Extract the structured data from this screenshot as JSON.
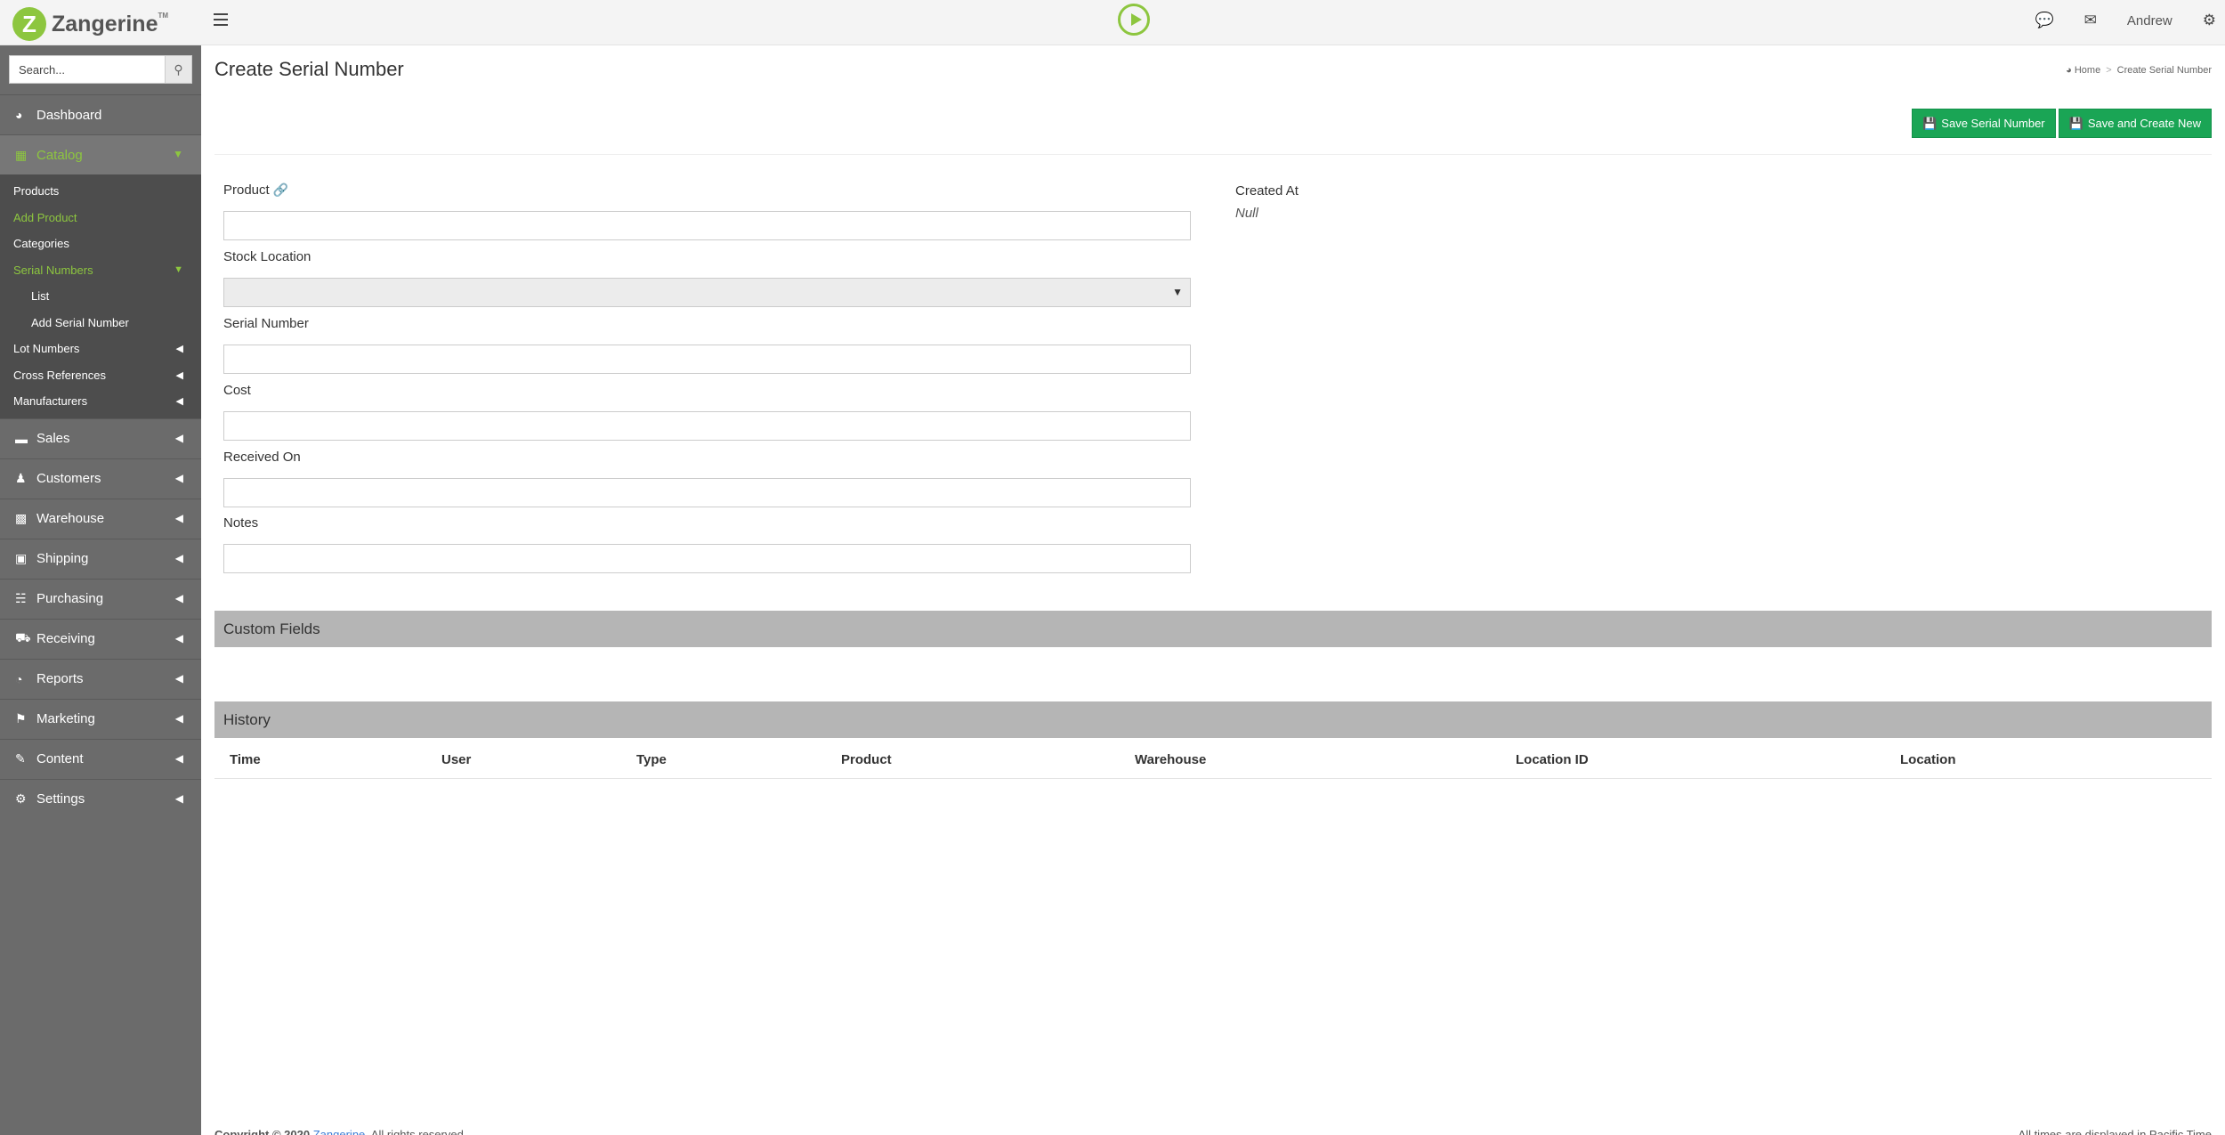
{
  "app": {
    "logo_text": "Zangerine",
    "logo_tm": "TM",
    "user_name": "Andrew"
  },
  "colors": {
    "brand_green": "#8dc63f",
    "button_green": "#1aa555",
    "sidebar_bg": "#6b6b6b"
  },
  "search": {
    "placeholder": "Search..."
  },
  "sidebar": {
    "dashboard": "Dashboard",
    "catalog": "Catalog",
    "catalog_items": {
      "products": "Products",
      "add_product": "Add Product",
      "categories": "Categories",
      "serial_numbers": "Serial Numbers",
      "serial_list": "List",
      "add_serial_number": "Add Serial Number",
      "lot_numbers": "Lot Numbers",
      "cross_references": "Cross References",
      "manufacturers": "Manufacturers"
    },
    "sales": "Sales",
    "customers": "Customers",
    "warehouse": "Warehouse",
    "shipping": "Shipping",
    "purchasing": "Purchasing",
    "receiving": "Receiving",
    "reports": "Reports",
    "marketing": "Marketing",
    "content": "Content",
    "settings": "Settings"
  },
  "page": {
    "title": "Create Serial Number",
    "breadcrumb_home": "Home",
    "breadcrumb_current": "Create Serial Number",
    "save_label": "Save Serial Number",
    "save_new_label": "Save and Create New"
  },
  "form": {
    "product_label": "Product",
    "stock_location_label": "Stock Location",
    "serial_number_label": "Serial Number",
    "cost_label": "Cost",
    "received_on_label": "Received On",
    "notes_label": "Notes",
    "created_at_label": "Created At",
    "created_at_value": "Null"
  },
  "sections": {
    "custom_fields": "Custom Fields",
    "history": "History"
  },
  "history": {
    "columns": [
      "Time",
      "User",
      "Type",
      "Product",
      "Warehouse",
      "Location ID",
      "Location"
    ]
  },
  "footer": {
    "copyright_prefix": "Copyright © 2020",
    "brand_link": "Zangerine",
    "rights": ". All rights reserved.",
    "timezone_note": "All times are displayed in Pacific Time"
  }
}
